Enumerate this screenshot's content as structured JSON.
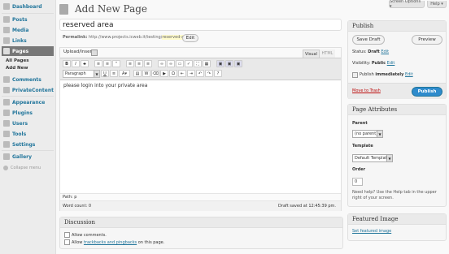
{
  "sidebar": {
    "items": [
      {
        "label": "Dashboard",
        "icon": "dashboard-icon"
      },
      {
        "label": "Posts",
        "icon": "posts-icon"
      },
      {
        "label": "Media",
        "icon": "media-icon"
      },
      {
        "label": "Links",
        "icon": "links-icon"
      },
      {
        "label": "Pages",
        "icon": "pages-icon"
      },
      {
        "label": "Comments",
        "icon": "comments-icon"
      },
      {
        "label": "PrivateContent",
        "icon": "privatecontent-icon"
      },
      {
        "label": "Appearance",
        "icon": "appearance-icon"
      },
      {
        "label": "Plugins",
        "icon": "plugins-icon"
      },
      {
        "label": "Users",
        "icon": "users-icon"
      },
      {
        "label": "Tools",
        "icon": "tools-icon"
      },
      {
        "label": "Settings",
        "icon": "settings-icon"
      },
      {
        "label": "Gallery",
        "icon": "gallery-icon"
      }
    ],
    "sub_items": [
      "All Pages",
      "Add New"
    ],
    "collapse_label": "Collapse menu"
  },
  "top": {
    "screen_options": "Screen Options ▾",
    "help": "Help ▾"
  },
  "header": {
    "title": "Add New Page"
  },
  "post": {
    "title_value": "reserved area",
    "permalink_label": "Permalink:",
    "permalink_base": "http://www.projects.icweb.it/testing/",
    "permalink_slug": "reserved-area/",
    "edit_label": "Edit"
  },
  "editor": {
    "upload_label": "Upload/Insert",
    "tab_visual": "Visual",
    "tab_html": "HTML",
    "format_select": "Paragraph",
    "content": "please login into your private area",
    "path": "Path: p",
    "word_count": "Word count: 0",
    "draft_saved": "Draft saved at 12:45:39 pm."
  },
  "discussion": {
    "title": "Discussion",
    "allow_comments": "Allow comments.",
    "allow_prefix": "Allow ",
    "allow_link": "trackbacks and pingbacks",
    "allow_suffix": " on this page."
  },
  "publish": {
    "title": "Publish",
    "save_draft": "Save Draft",
    "preview": "Preview",
    "status_label": "Status:",
    "status_value": "Draft",
    "visibility_label": "Visibility:",
    "visibility_value": "Public",
    "publish_label": "Publish",
    "publish_value": "immediately",
    "edit": "Edit",
    "trash": "Move to Trash",
    "publish_button": "Publish"
  },
  "attributes": {
    "title": "Page Attributes",
    "parent_label": "Parent",
    "parent_value": "(no parent)",
    "template_label": "Template",
    "template_value": "Default Template",
    "order_label": "Order",
    "order_value": "0",
    "help_text": "Need help? Use the Help tab in the upper right of your screen."
  },
  "featured": {
    "title": "Featured Image",
    "link": "Set featured image"
  },
  "colors": {
    "link": "#21759b",
    "active_menu": "#777777",
    "primary_button": "#2e8bcc",
    "trash": "#bc0b0b"
  }
}
